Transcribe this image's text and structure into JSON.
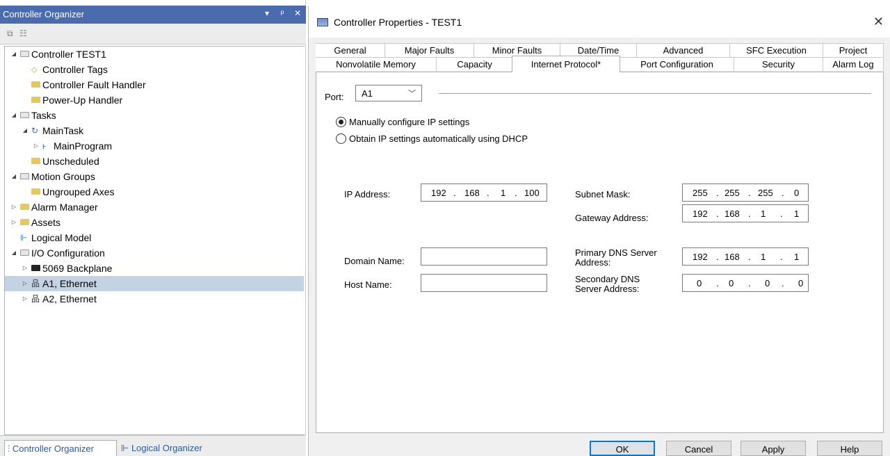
{
  "organizer": {
    "title": "Controller Organizer",
    "title_buttons": [
      "▾",
      "ᵖ",
      "✕"
    ],
    "tree": [
      {
        "label": "Controller TEST1",
        "level": 0,
        "arrow": "◢",
        "icon": "folder-open"
      },
      {
        "label": "Controller Tags",
        "level": 1,
        "arrow": "",
        "icon": "tag"
      },
      {
        "label": "Controller Fault Handler",
        "level": 1,
        "arrow": "",
        "icon": "folder"
      },
      {
        "label": "Power-Up Handler",
        "level": 1,
        "arrow": "",
        "icon": "folder"
      },
      {
        "label": "Tasks",
        "level": 0,
        "arrow": "◢",
        "icon": "folder-open"
      },
      {
        "label": "MainTask",
        "level": 1,
        "arrow": "◢",
        "icon": "task"
      },
      {
        "label": "MainProgram",
        "level": 2,
        "arrow": "▷",
        "icon": "program"
      },
      {
        "label": "Unscheduled",
        "level": 1,
        "arrow": "",
        "icon": "folder"
      },
      {
        "label": "Motion Groups",
        "level": 0,
        "arrow": "◢",
        "icon": "folder-open"
      },
      {
        "label": "Ungrouped Axes",
        "level": 1,
        "arrow": "",
        "icon": "folder"
      },
      {
        "label": "Alarm Manager",
        "level": 0,
        "arrow": "▷",
        "icon": "folder"
      },
      {
        "label": "Assets",
        "level": 0,
        "arrow": "▷",
        "icon": "folder"
      },
      {
        "label": "Logical Model",
        "level": 0,
        "arrow": "",
        "icon": "model"
      },
      {
        "label": "I/O Configuration",
        "level": 0,
        "arrow": "◢",
        "icon": "folder-open"
      },
      {
        "label": "5069 Backplane",
        "level": 1,
        "arrow": "▷",
        "icon": "backplane"
      },
      {
        "label": "A1, Ethernet",
        "level": 1,
        "arrow": "▷",
        "icon": "ethernet",
        "selected": true
      },
      {
        "label": "A2, Ethernet",
        "level": 1,
        "arrow": "▷",
        "icon": "ethernet"
      }
    ],
    "bottom_tabs": [
      "Controller Organizer",
      "Logical Organizer"
    ]
  },
  "dialog": {
    "title": "Controller Properties - TEST1",
    "tabs_row1": [
      "General",
      "Major Faults",
      "Minor Faults",
      "Date/Time",
      "Advanced",
      "SFC Execution",
      "Project"
    ],
    "tabs_row2": [
      "Nonvolatile Memory",
      "Capacity",
      "Internet Protocol*",
      "Port Configuration",
      "Security",
      "Alarm Log"
    ],
    "active_tab": "Internet Protocol*",
    "port_label": "Port:",
    "port_value": "A1",
    "radio_manual": "Manually configure IP settings",
    "radio_dhcp": "Obtain IP settings automatically using DHCP",
    "ip_label": "IP Address:",
    "ip": [
      "192",
      "168",
      "1",
      "100"
    ],
    "subnet_label": "Subnet Mask:",
    "subnet": [
      "255",
      "255",
      "255",
      "0"
    ],
    "gateway_label": "Gateway Address:",
    "gateway": [
      "192",
      "168",
      "1",
      "1"
    ],
    "domain_label": "Domain Name:",
    "domain_value": "",
    "host_label": "Host Name:",
    "host_value": "",
    "primary_dns_label_1": "Primary DNS Server",
    "primary_dns_label_2": "Address:",
    "primary_dns": [
      "192",
      "168",
      "1",
      "1"
    ],
    "secondary_dns_label_1": "Secondary DNS",
    "secondary_dns_label_2": "Server Address:",
    "secondary_dns": [
      "0",
      "0",
      "0",
      "0"
    ],
    "buttons": {
      "ok": "OK",
      "cancel": "Cancel",
      "apply": "Apply",
      "help": "Help"
    }
  }
}
